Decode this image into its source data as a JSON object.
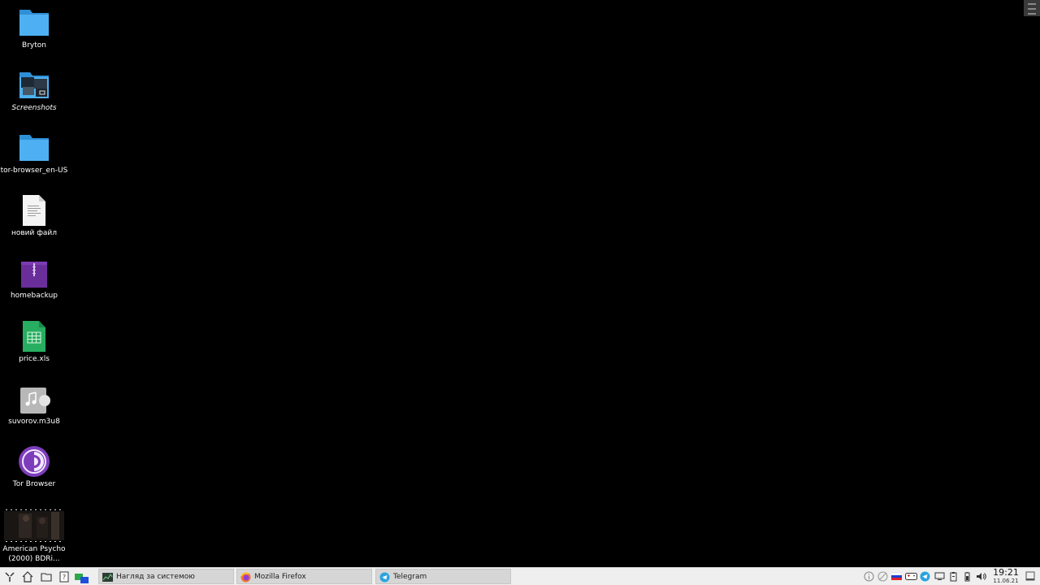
{
  "desktop": {
    "icons": [
      {
        "label": "Bryton",
        "icon": "folder-icon"
      },
      {
        "label": "Screenshots",
        "icon": "screenshots-folder-icon"
      },
      {
        "label": "tor-browser_en-US",
        "icon": "folder-icon"
      },
      {
        "label": "новий файл",
        "icon": "text-file-icon"
      },
      {
        "label": "homebackup",
        "icon": "archive-icon"
      },
      {
        "label": "price.xls",
        "icon": "spreadsheet-icon"
      },
      {
        "label": "suvorov.m3u8",
        "icon": "playlist-icon"
      },
      {
        "label": "Tor Browser",
        "icon": "tor-browser-icon"
      },
      {
        "label": "American Psycho (2000) BDRi...",
        "icon": "video-thumbnail"
      }
    ]
  },
  "taskbar": {
    "launchers": [
      "app-menu-icon",
      "home-icon",
      "file-manager-icon",
      "help-icon",
      "desktop-pager-icon"
    ],
    "tasks": [
      {
        "label": "Нагляд за системою",
        "icon": "system-monitor-icon"
      },
      {
        "label": "Mozilla Firefox",
        "icon": "firefox-icon"
      },
      {
        "label": "Telegram",
        "icon": "telegram-icon"
      }
    ],
    "tray": [
      "info-icon",
      "network-icon",
      "russian-flag-icon",
      "gamepad-icon",
      "telegram-tray-icon",
      "display-icon",
      "clipboard-icon",
      "battery-icon",
      "usb-icon",
      "volume-icon"
    ],
    "clock": {
      "time": "19:21",
      "date": "11.06.21"
    }
  },
  "colors": {
    "desktop_bg": "#000000",
    "taskbar_bg": "#efefef",
    "folder_blue": "#3fa2e8"
  }
}
